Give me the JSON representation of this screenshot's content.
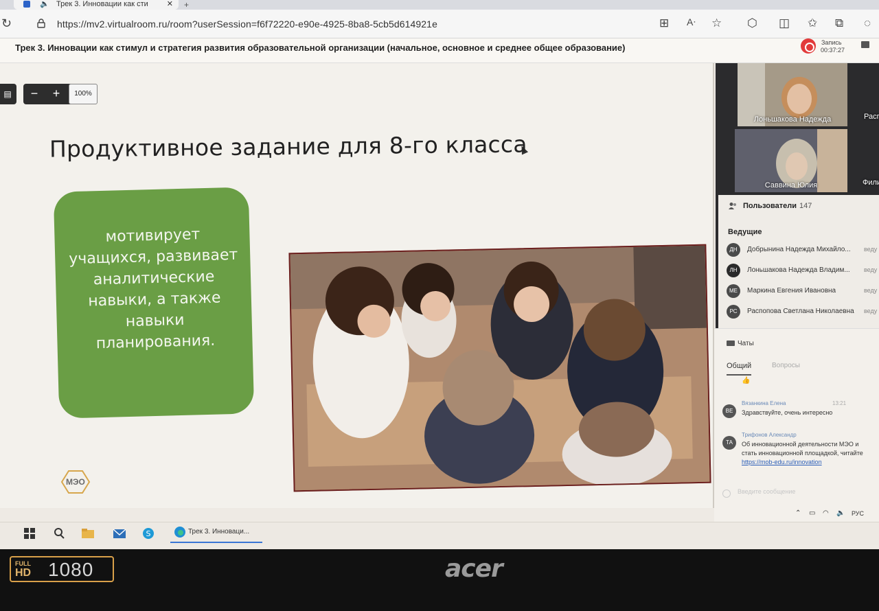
{
  "browser": {
    "tab_title": "Трек 3. Инновации как сти",
    "url": "https://mv2.virtualroom.ru/room?userSession=f6f72220-e90e-4925-8ba8-5cb5d614921e"
  },
  "conference": {
    "title": "Трек 3. Инновации как стимул и стратегия развития образовательной организации (начальное, основное и среднее общее образование)",
    "record_label": "Запись",
    "record_time": "00:37:27"
  },
  "presentation": {
    "zoom_minus": "−",
    "zoom_plus": "+",
    "zoom_value": "100%",
    "slide_title": "Продуктивное задание для 8-го класса",
    "green_text": "мотивирует учащихся, развивает аналитические навыки, а также навыки планирования.",
    "logo_text": "МЭО"
  },
  "videos": [
    {
      "name": "Лоньшакова Надежда",
      "side_name": "Расп"
    },
    {
      "name": "Саввина Юлия",
      "side_name": "Фили"
    }
  ],
  "users": {
    "heading": "Пользователи",
    "count": "147",
    "hosts_label": "Ведущие",
    "hosts": [
      {
        "initials": "ДН",
        "name": "Добрынина Надежда Михайло...",
        "role": "веду"
      },
      {
        "initials": "ЛН",
        "name": "Лоньшакова Надежда Владим...",
        "role": "веду"
      },
      {
        "initials": "МЕ",
        "name": "Маркина Евгения Ивановна",
        "role": "веду"
      },
      {
        "initials": "РС",
        "name": "Распопова Светлана Николаевна",
        "role": "веду"
      }
    ]
  },
  "chats": {
    "heading": "Чаты",
    "tab_general": "Общий",
    "tab_questions": "Вопросы",
    "thumb": "👍",
    "messages": [
      {
        "initials": "ВЕ",
        "author": "Вязанкина Елена",
        "time": "13:21",
        "text": "Здравствуйте, очень интересно"
      },
      {
        "initials": "ТА",
        "author": "Трифонов Александр",
        "text1": "Об инновационной деятельности МЭО и",
        "text2": "стать инновационной площадкой, читайте",
        "link": "https://mob-edu.ru/innovation"
      }
    ],
    "input_placeholder": "Введите сообщение"
  },
  "taskbar": {
    "app_label": "Трек 3. Инноваци...",
    "lang": "РУС"
  },
  "bezel": {
    "badge_full": "FULL",
    "badge_hd": "HD",
    "badge_1080": "1080",
    "brand": "acer"
  },
  "colors": {
    "green_box": "#6a9e45",
    "record_red": "#e23a3a",
    "photo_frame": "#6b1f1f"
  }
}
